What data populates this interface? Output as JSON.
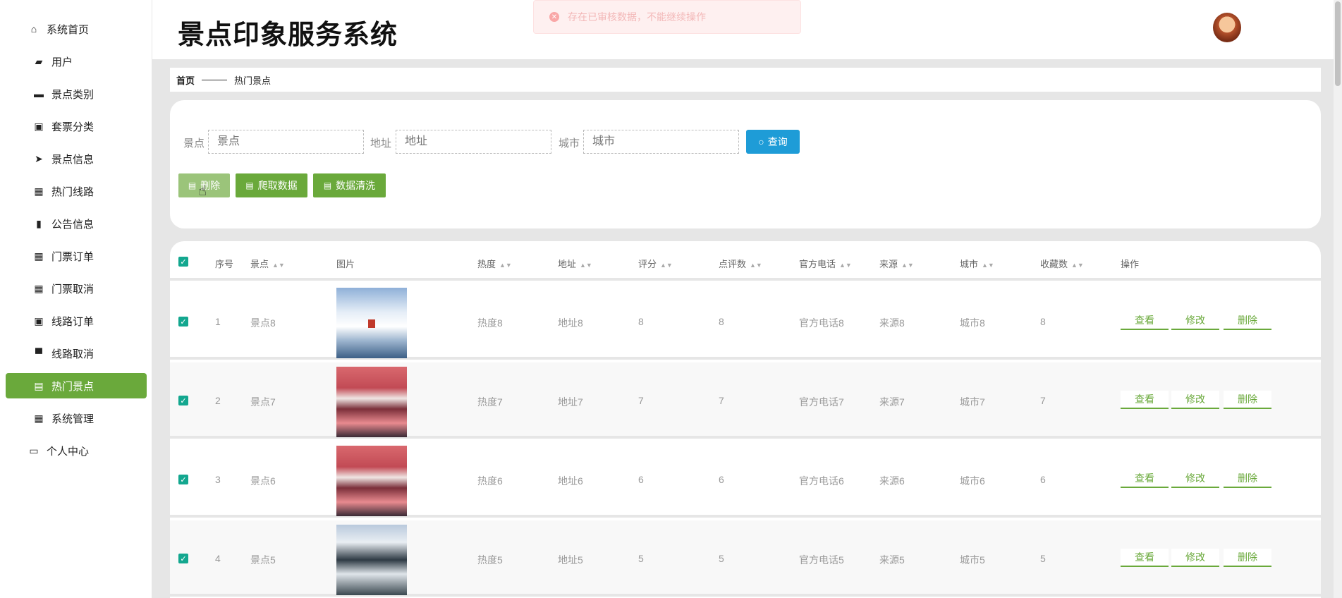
{
  "app": {
    "title": "景点印象服务系统"
  },
  "toast": {
    "text": "存在已审核数据，不能继续操作"
  },
  "sidebar": {
    "items": [
      {
        "label": "系统首页",
        "icon": "home-icon"
      },
      {
        "label": "用户",
        "icon": "ticket-icon"
      },
      {
        "label": "景点类别",
        "icon": "wallet-icon"
      },
      {
        "label": "套票分类",
        "icon": "clipboard-icon"
      },
      {
        "label": "景点信息",
        "icon": "send-icon"
      },
      {
        "label": "热门线路",
        "icon": "grid-icon"
      },
      {
        "label": "公告信息",
        "icon": "books-icon"
      },
      {
        "label": "门票订单",
        "icon": "grid-icon"
      },
      {
        "label": "门票取消",
        "icon": "grid-icon"
      },
      {
        "label": "线路订单",
        "icon": "clipboard-check-icon"
      },
      {
        "label": "线路取消",
        "icon": "monitor-icon"
      },
      {
        "label": "热门景点",
        "icon": "printer-icon"
      },
      {
        "label": "系统管理",
        "icon": "grid-icon"
      },
      {
        "label": "个人中心",
        "icon": "panel-icon"
      }
    ]
  },
  "breadcrumb": {
    "home": "首页",
    "current": "热门景点"
  },
  "search": {
    "fields": [
      {
        "label": "景点",
        "placeholder": "景点"
      },
      {
        "label": "地址",
        "placeholder": "地址"
      },
      {
        "label": "城市",
        "placeholder": "城市"
      }
    ],
    "query_label": "查询"
  },
  "actions": {
    "delete_label": "删除",
    "crawl_label": "爬取数据",
    "clean_label": "数据清洗"
  },
  "table": {
    "columns": [
      "序号",
      "景点",
      "图片",
      "热度",
      "地址",
      "评分",
      "点评数",
      "官方电话",
      "来源",
      "城市",
      "收藏数",
      "操作"
    ],
    "row_actions": {
      "view": "查看",
      "edit": "修改",
      "delete": "删除"
    },
    "rows": [
      {
        "index": "1",
        "name": "景点8",
        "heat": "热度8",
        "address": "地址8",
        "score": "8",
        "reviews": "8",
        "phone": "官方电话8",
        "source": "来源8",
        "city": "城市8",
        "favorites": "8",
        "image": "snow-cablecar"
      },
      {
        "index": "2",
        "name": "景点7",
        "heat": "热度7",
        "address": "地址7",
        "score": "7",
        "reviews": "7",
        "phone": "官方电话7",
        "source": "来源7",
        "city": "城市7",
        "favorites": "7",
        "image": "red-mountain"
      },
      {
        "index": "3",
        "name": "景点6",
        "heat": "热度6",
        "address": "地址6",
        "score": "6",
        "reviews": "6",
        "phone": "官方电话6",
        "source": "来源6",
        "city": "城市6",
        "favorites": "6",
        "image": "red-mountain"
      },
      {
        "index": "4",
        "name": "景点5",
        "heat": "热度5",
        "address": "地址5",
        "score": "5",
        "reviews": "5",
        "phone": "官方电话5",
        "source": "来源5",
        "city": "城市5",
        "favorites": "5",
        "image": "misty-peaks"
      }
    ]
  },
  "colors": {
    "accent": "#6aa93b",
    "query": "#1e9cd7",
    "checkbox": "#13a78f"
  }
}
